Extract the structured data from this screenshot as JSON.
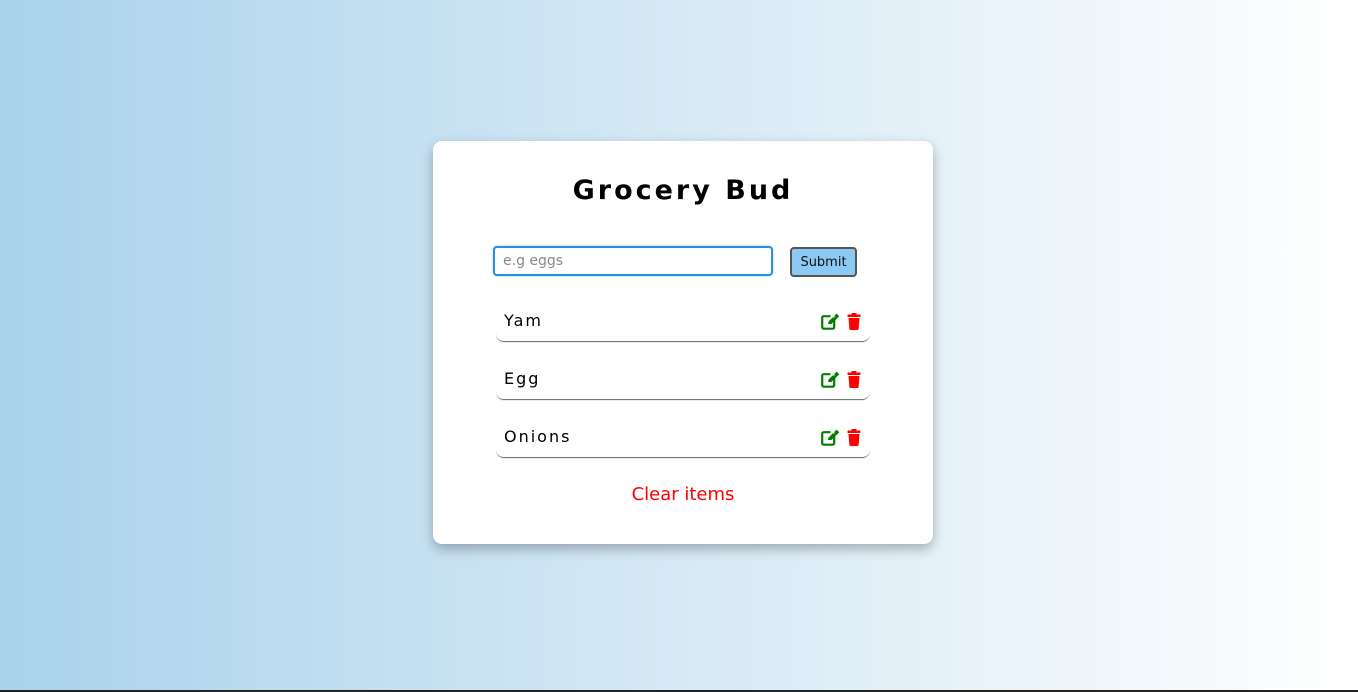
{
  "app": {
    "title": "Grocery Bud"
  },
  "form": {
    "input_value": "",
    "input_placeholder": "e.g eggs",
    "submit_label": "Submit"
  },
  "items": [
    {
      "label": "Yam",
      "edit_icon": "edit-icon",
      "delete_icon": "trash-icon"
    },
    {
      "label": "Egg",
      "edit_icon": "edit-icon",
      "delete_icon": "trash-icon"
    },
    {
      "label": "Onions",
      "edit_icon": "edit-icon",
      "delete_icon": "trash-icon"
    }
  ],
  "clear_label": "Clear items",
  "colors": {
    "edit": "#008000",
    "delete": "#ff0000",
    "submit_bg": "#8cc9f5",
    "input_border": "#2a8fdc",
    "clear_text": "#ff0000"
  }
}
